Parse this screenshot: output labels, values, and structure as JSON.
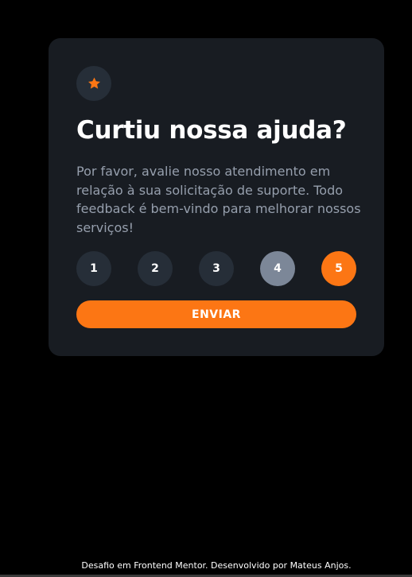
{
  "card": {
    "icon": "star-icon",
    "title": "Curtiu nossa ajuda?",
    "description": "Por favor, avalie nosso atendimento em relação à sua solicitação de suporte. Todo feedback é bem-vindo para melhorar nossos serviços!",
    "ratings": [
      "1",
      "2",
      "3",
      "4",
      "5"
    ],
    "hovered_rating": "4",
    "selected_rating": "5",
    "submit_label": "ENVIAR"
  },
  "footer": {
    "text": "Desafio em Frontend Mentor. Desenvolvido por Mateus Anjos."
  },
  "colors": {
    "background": "#000000",
    "card": "#181c22",
    "circle": "#262e38",
    "hover": "#7c8798",
    "accent": "#fc7614",
    "text_muted": "#969fad",
    "text": "#ffffff"
  }
}
